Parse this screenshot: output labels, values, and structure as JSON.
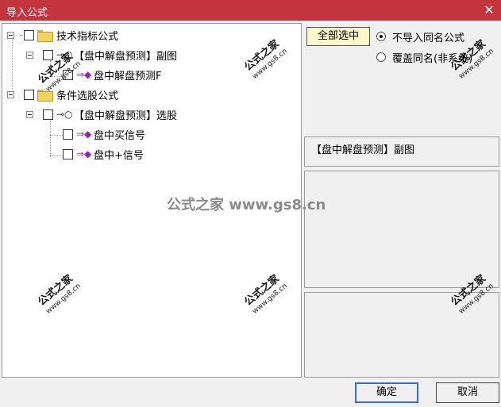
{
  "window": {
    "title": "导入公式",
    "close_glyph": "✕"
  },
  "tree": {
    "nodes": [
      {
        "label": "技术指标公式",
        "type": "folder"
      },
      {
        "label": "【盘中解盘预测】副图",
        "type": "key"
      },
      {
        "label": "盘中解盘预测F",
        "type": "gem"
      },
      {
        "label": "条件选股公式",
        "type": "folder"
      },
      {
        "label": "【盘中解盘预测】选股",
        "type": "key"
      },
      {
        "label": "盘中买信号",
        "type": "gem"
      },
      {
        "label": "盘中+信号",
        "type": "gem"
      }
    ]
  },
  "options": {
    "select_all_label": "全部选中",
    "radio_skip_label": "不导入同名公式",
    "radio_overwrite_label": "覆盖同名(非系统)",
    "selected": "skip"
  },
  "preview": {
    "name": "【盘中解盘预测】副图"
  },
  "buttons": {
    "ok_label": "确定",
    "cancel_label": "取消"
  },
  "watermark": {
    "text": "公式之家",
    "url": "www.gs8.cn",
    "center_text": "公式之家 www.gs8.cn"
  },
  "icons": {
    "close": "close-icon",
    "expander": "collapse-icon",
    "folder": "folder-icon",
    "key": "key-icon",
    "gem": "gem-icon"
  },
  "colors": {
    "titlebar": "#c4343c",
    "select_all_bg": "#fff7c9",
    "ok_border": "#3b6cc7",
    "gem": "#9b1fb5",
    "folder": "#f3d35c"
  }
}
